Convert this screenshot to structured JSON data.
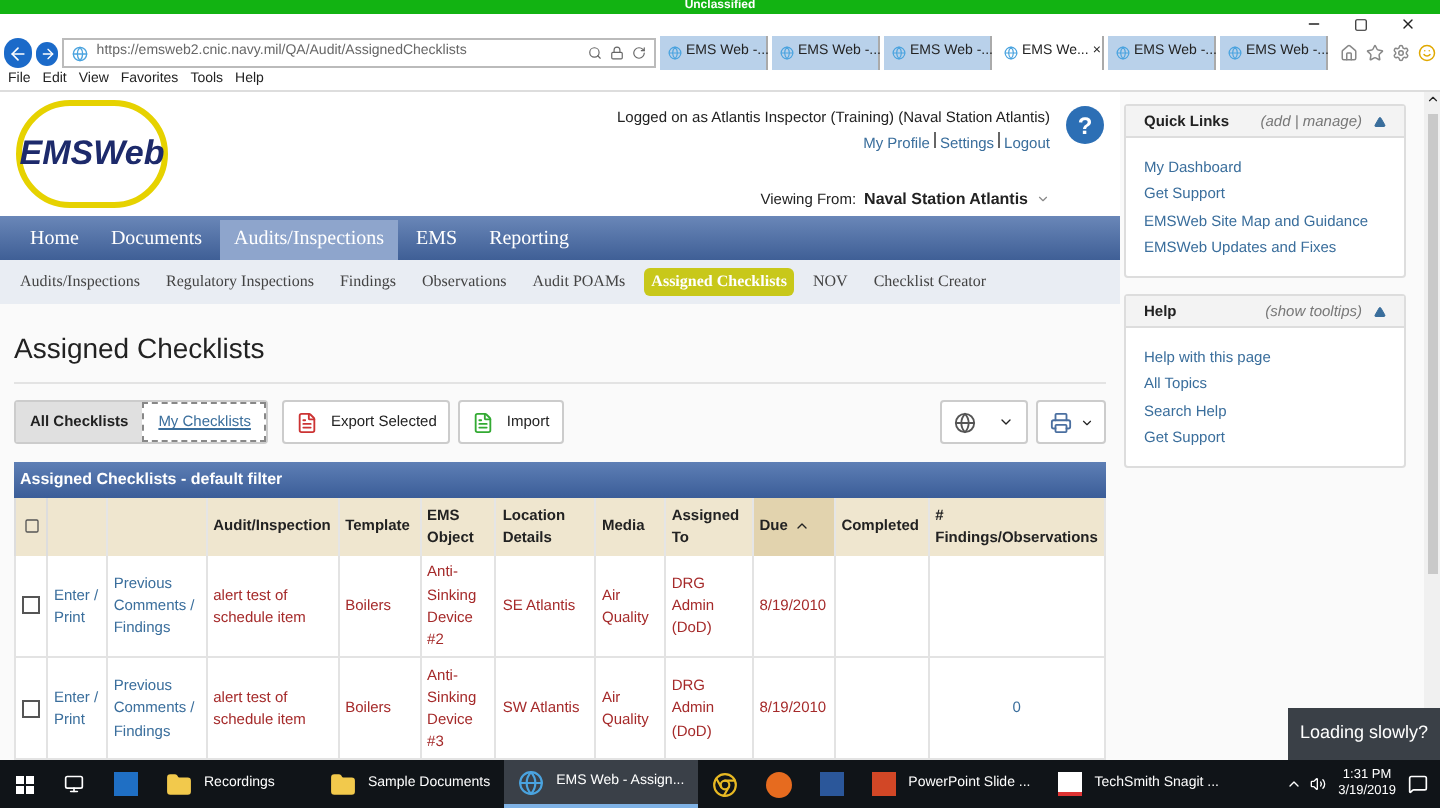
{
  "classification_banner": "Unclassified",
  "browser": {
    "address": "https://emsweb2.cnic.navy.mil/QA/Audit/AssignedChecklists",
    "tabs": [
      {
        "label": "EMS Web -...",
        "selected": false
      },
      {
        "label": "EMS Web -...",
        "selected": false
      },
      {
        "label": "EMS Web -...",
        "selected": false
      },
      {
        "label": "EMS We...",
        "selected": true
      },
      {
        "label": "EMS Web -...",
        "selected": false
      },
      {
        "label": "EMS Web -...",
        "selected": false
      }
    ],
    "close_tab": "×",
    "menu": [
      "File",
      "Edit",
      "View",
      "Favorites",
      "Tools",
      "Help"
    ]
  },
  "header": {
    "logo": "EMSWeb",
    "logged_on": "Logged on as Atlantis Inspector (Training) (Naval Station Atlantis)",
    "links": [
      "My Profile",
      "Settings",
      "Logout"
    ],
    "viewing_from_label": "Viewing From:",
    "viewing_from": "Naval Station Atlantis",
    "help_icon": "?"
  },
  "nav": [
    {
      "label": "Home",
      "selected": false
    },
    {
      "label": "Documents",
      "selected": false
    },
    {
      "label": "Audits/Inspections",
      "selected": true
    },
    {
      "label": "EMS",
      "selected": false
    },
    {
      "label": "Reporting",
      "selected": false
    }
  ],
  "subnav": [
    {
      "label": "Audits/Inspections",
      "selected": false
    },
    {
      "label": "Regulatory Inspections",
      "selected": false
    },
    {
      "label": "Findings",
      "selected": false
    },
    {
      "label": "Observations",
      "selected": false
    },
    {
      "label": "Audit POAMs",
      "selected": false
    },
    {
      "label": "Assigned Checklists",
      "selected": true
    },
    {
      "label": "NOV",
      "selected": false
    },
    {
      "label": "Checklist Creator",
      "selected": false
    }
  ],
  "page_title": "Assigned Checklists",
  "filter_tabs": [
    {
      "label": "All Checklists",
      "selected": true
    },
    {
      "label": "My Checklists",
      "selected": false
    }
  ],
  "toolbar": {
    "export": "Export Selected",
    "import": "Import"
  },
  "table": {
    "title": "Assigned Checklists - default filter",
    "columns": [
      {
        "label": "Audit/Inspection",
        "sorted": false
      },
      {
        "label": "Template",
        "sorted": false
      },
      {
        "label": "EMS Object",
        "sorted": false
      },
      {
        "label": "Location Details",
        "sorted": false
      },
      {
        "label": "Media",
        "sorted": false
      },
      {
        "label": "Assigned To",
        "sorted": false
      },
      {
        "label": "Due",
        "sorted": true
      },
      {
        "label": "Completed",
        "sorted": false
      },
      {
        "label": "# Findings/Observations",
        "sorted": false
      }
    ],
    "rows": [
      {
        "checked": false,
        "enter": "Enter / Print",
        "previous": "Previous Comments / Findings",
        "audit": "alert test of schedule item",
        "template": "Boilers",
        "ems_object": "Anti-Sinking Device #2",
        "location": "SE Atlantis",
        "media": "Air Quality",
        "assigned_to": "DRG Admin (DoD)",
        "due": "8/19/2010"
      },
      {
        "checked": false,
        "enter": "Enter / Print",
        "previous": "Previous Comments / Findings",
        "audit": "alert test of schedule item",
        "template": "Boilers",
        "ems_object": "Anti-Sinking Device #3",
        "location": "SW Atlantis",
        "media": "Air Quality",
        "assigned_to": "DRG Admin (DoD)",
        "due": "8/19/2010",
        "findings": "0"
      }
    ]
  },
  "sidebar": [
    {
      "title": "Quick Links",
      "actions": "(add | manage)",
      "links": [
        "My Dashboard",
        "Get Support",
        "EMSWeb Site Map and Guidance",
        "EMSWeb Updates and Fixes"
      ]
    },
    {
      "title": "Help",
      "actions": "(show tooltips)",
      "links": [
        "Help with this page",
        "All Topics",
        "Search Help",
        "Get Support"
      ]
    }
  ],
  "loading_popup": "Loading slowly?",
  "taskbar": {
    "items": [
      {
        "kind": "outlook",
        "selected": false
      },
      {
        "label": "Recordings",
        "kind": "folder",
        "selected": false
      },
      {
        "label": "Sample Documents",
        "kind": "folder",
        "selected": false
      },
      {
        "label": "EMS Web - Assign...",
        "kind": "ie",
        "selected": true
      },
      {
        "kind": "chrome",
        "selected": false
      },
      {
        "kind": "firefox",
        "selected": false
      },
      {
        "kind": "word",
        "selected": false
      },
      {
        "label": "PowerPoint Slide ...",
        "kind": "ppt",
        "selected": false
      },
      {
        "label": "TechSmith Snagit ...",
        "kind": "snagit",
        "selected": false
      }
    ],
    "time": "1:31 PM",
    "date": "3/19/2019"
  }
}
